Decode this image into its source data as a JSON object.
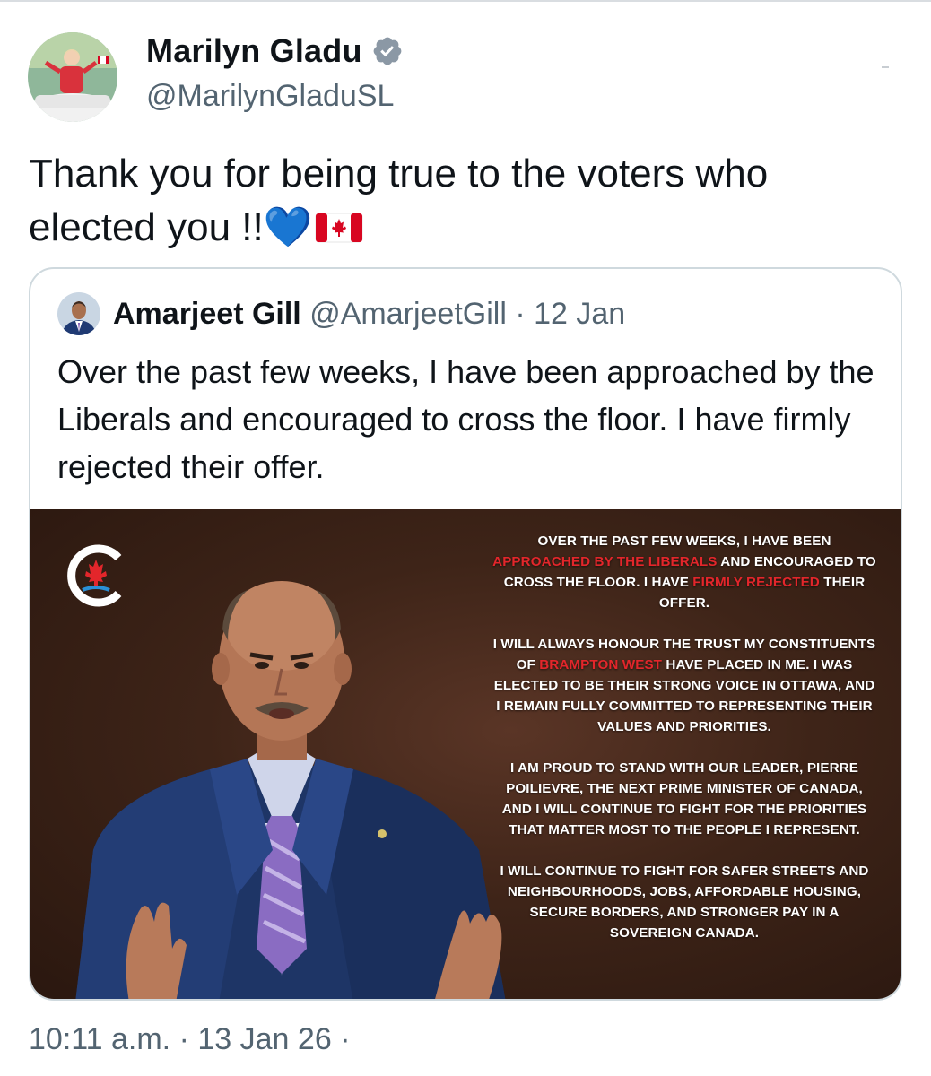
{
  "author": {
    "display_name": "Marilyn Gladu",
    "handle": "@MarilynGladuSL",
    "verified": true
  },
  "tweet": {
    "text": "Thank you for being true to the voters who elected you !!",
    "emoji_heart": "💙",
    "emoji_flag": "canada-flag"
  },
  "quoted": {
    "display_name": "Amarjeet Gill",
    "handle": "@AmarjeetGill",
    "separator": "·",
    "date": "12 Jan",
    "text": "Over the past few weeks, I have been approached by the Liberals and encouraged to cross the floor. I have firmly rejected their offer.",
    "image_statement": {
      "p1_a": "OVER THE PAST FEW WEEKS, I HAVE BEEN",
      "p1_hl1": "APPROACHED BY THE LIBERALS",
      "p1_b": "AND ENCOURAGED TO CROSS THE FLOOR. I HAVE",
      "p1_hl2": "FIRMLY REJECTED",
      "p1_c": "THEIR OFFER.",
      "p2_a": "I WILL ALWAYS HONOUR THE TRUST MY CONSTITUENTS OF",
      "p2_hl": "BRAMPTON WEST",
      "p2_b": "HAVE PLACED IN ME. I WAS ELECTED TO BE THEIR STRONG VOICE IN OTTAWA, AND I REMAIN FULLY COMMITTED TO REPRESENTING THEIR VALUES AND PRIORITIES.",
      "p3": "I AM PROUD TO STAND WITH OUR LEADER, PIERRE POILIEVRE, THE NEXT PRIME MINISTER OF CANADA, AND I WILL CONTINUE TO FIGHT FOR THE PRIORITIES THAT MATTER MOST TO THE PEOPLE I REPRESENT.",
      "p4": "I WILL CONTINUE TO FIGHT FOR SAFER STREETS AND NEIGHBOURHOODS, JOBS, AFFORDABLE HOUSING, SECURE BORDERS, AND STRONGER PAY IN A SOVEREIGN CANADA.",
      "highlight_color": "#e3262b"
    }
  },
  "footer": {
    "time": "10:11 a.m.",
    "separator": "·",
    "date": "13 Jan 26",
    "trailing_separator": "·"
  },
  "colors": {
    "text": "#0f1419",
    "muted": "#536471",
    "border": "#cfd9de",
    "verified": "#8b98a5",
    "heart": "#1d9bf0"
  }
}
